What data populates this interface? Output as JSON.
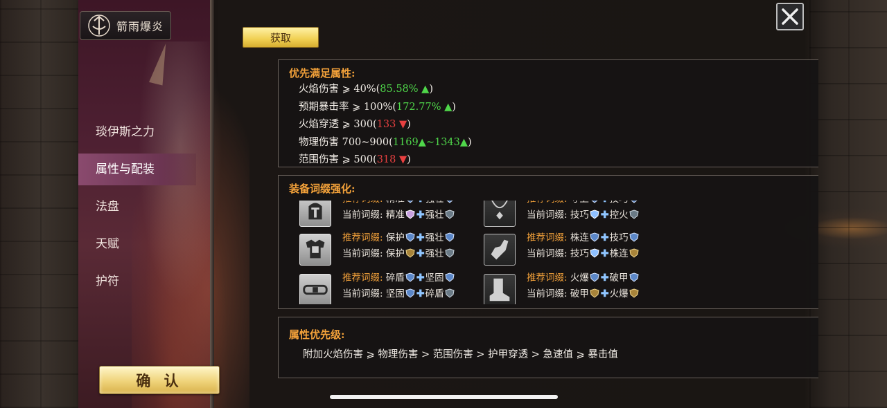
{
  "header": {
    "emblem_title": "箭雨爆炎",
    "acquire_label": "获取"
  },
  "sidebar": {
    "items": [
      {
        "label": "琰伊斯之力",
        "active": false
      },
      {
        "label": "属性与配装",
        "active": true
      },
      {
        "label": "法盘",
        "active": false
      },
      {
        "label": "天赋",
        "active": false
      },
      {
        "label": "护符",
        "active": false
      }
    ],
    "confirm_label": "确 认"
  },
  "requirements": {
    "title": "优先满足属性:",
    "items": [
      {
        "prefix": "火焰伤害 ⩾ 40%(",
        "value": "85.58%",
        "trend": "up",
        "suffix": ")"
      },
      {
        "prefix": "预期暴击率 ⩾ 100%(",
        "value": "172.77%",
        "trend": "up",
        "suffix": ")"
      },
      {
        "prefix": "火焰穿透 ⩾ 300(",
        "value": "133",
        "trend": "down",
        "suffix": ")"
      },
      {
        "prefix": "物理伤害 700~900(",
        "value": "1169▲~1343",
        "trend": "up",
        "suffix": ")"
      },
      {
        "prefix": "范围伤害 ⩾ 500(",
        "value": "318",
        "trend": "down",
        "suffix": ")"
      }
    ]
  },
  "affixes": {
    "title": "装备词缀强化:",
    "rec_label": "推荐词缀:",
    "cur_label": "当前词缀:",
    "slots": [
      {
        "icon": "helmet-icon",
        "rec_a": "精准",
        "rec_b": "强壮",
        "cur_a": "精准",
        "cur_b": "强壮"
      },
      {
        "icon": "necklace-icon",
        "rec_a": "守卫",
        "rec_b": "技巧",
        "cur_a": "技巧",
        "cur_b": "控火"
      },
      {
        "icon": "chest-armor-icon",
        "rec_a": "保护",
        "rec_b": "强壮",
        "cur_a": "保护",
        "cur_b": "强壮"
      },
      {
        "icon": "gauntlet-icon",
        "rec_a": "株连",
        "rec_b": "技巧",
        "cur_a": "技巧",
        "cur_b": "株连"
      },
      {
        "icon": "belt-icon",
        "rec_a": "碎盾",
        "rec_b": "坚固",
        "cur_a": "坚固",
        "cur_b": "碎盾"
      },
      {
        "icon": "boots-icon",
        "rec_a": "火爆",
        "rec_b": "破甲",
        "cur_a": "破甲",
        "cur_b": "火爆"
      }
    ]
  },
  "priority": {
    "title": "属性优先级:",
    "text": "附加火焰伤害 ⩾ 物理伤害 > 范围伤害 > 护甲穿透 > 急速值 ⩾ 暴击值"
  },
  "colors": {
    "accent": "#f4a23a",
    "up": "#4fd64a",
    "down": "#e84040",
    "nav_active": "#8a4a6e"
  }
}
